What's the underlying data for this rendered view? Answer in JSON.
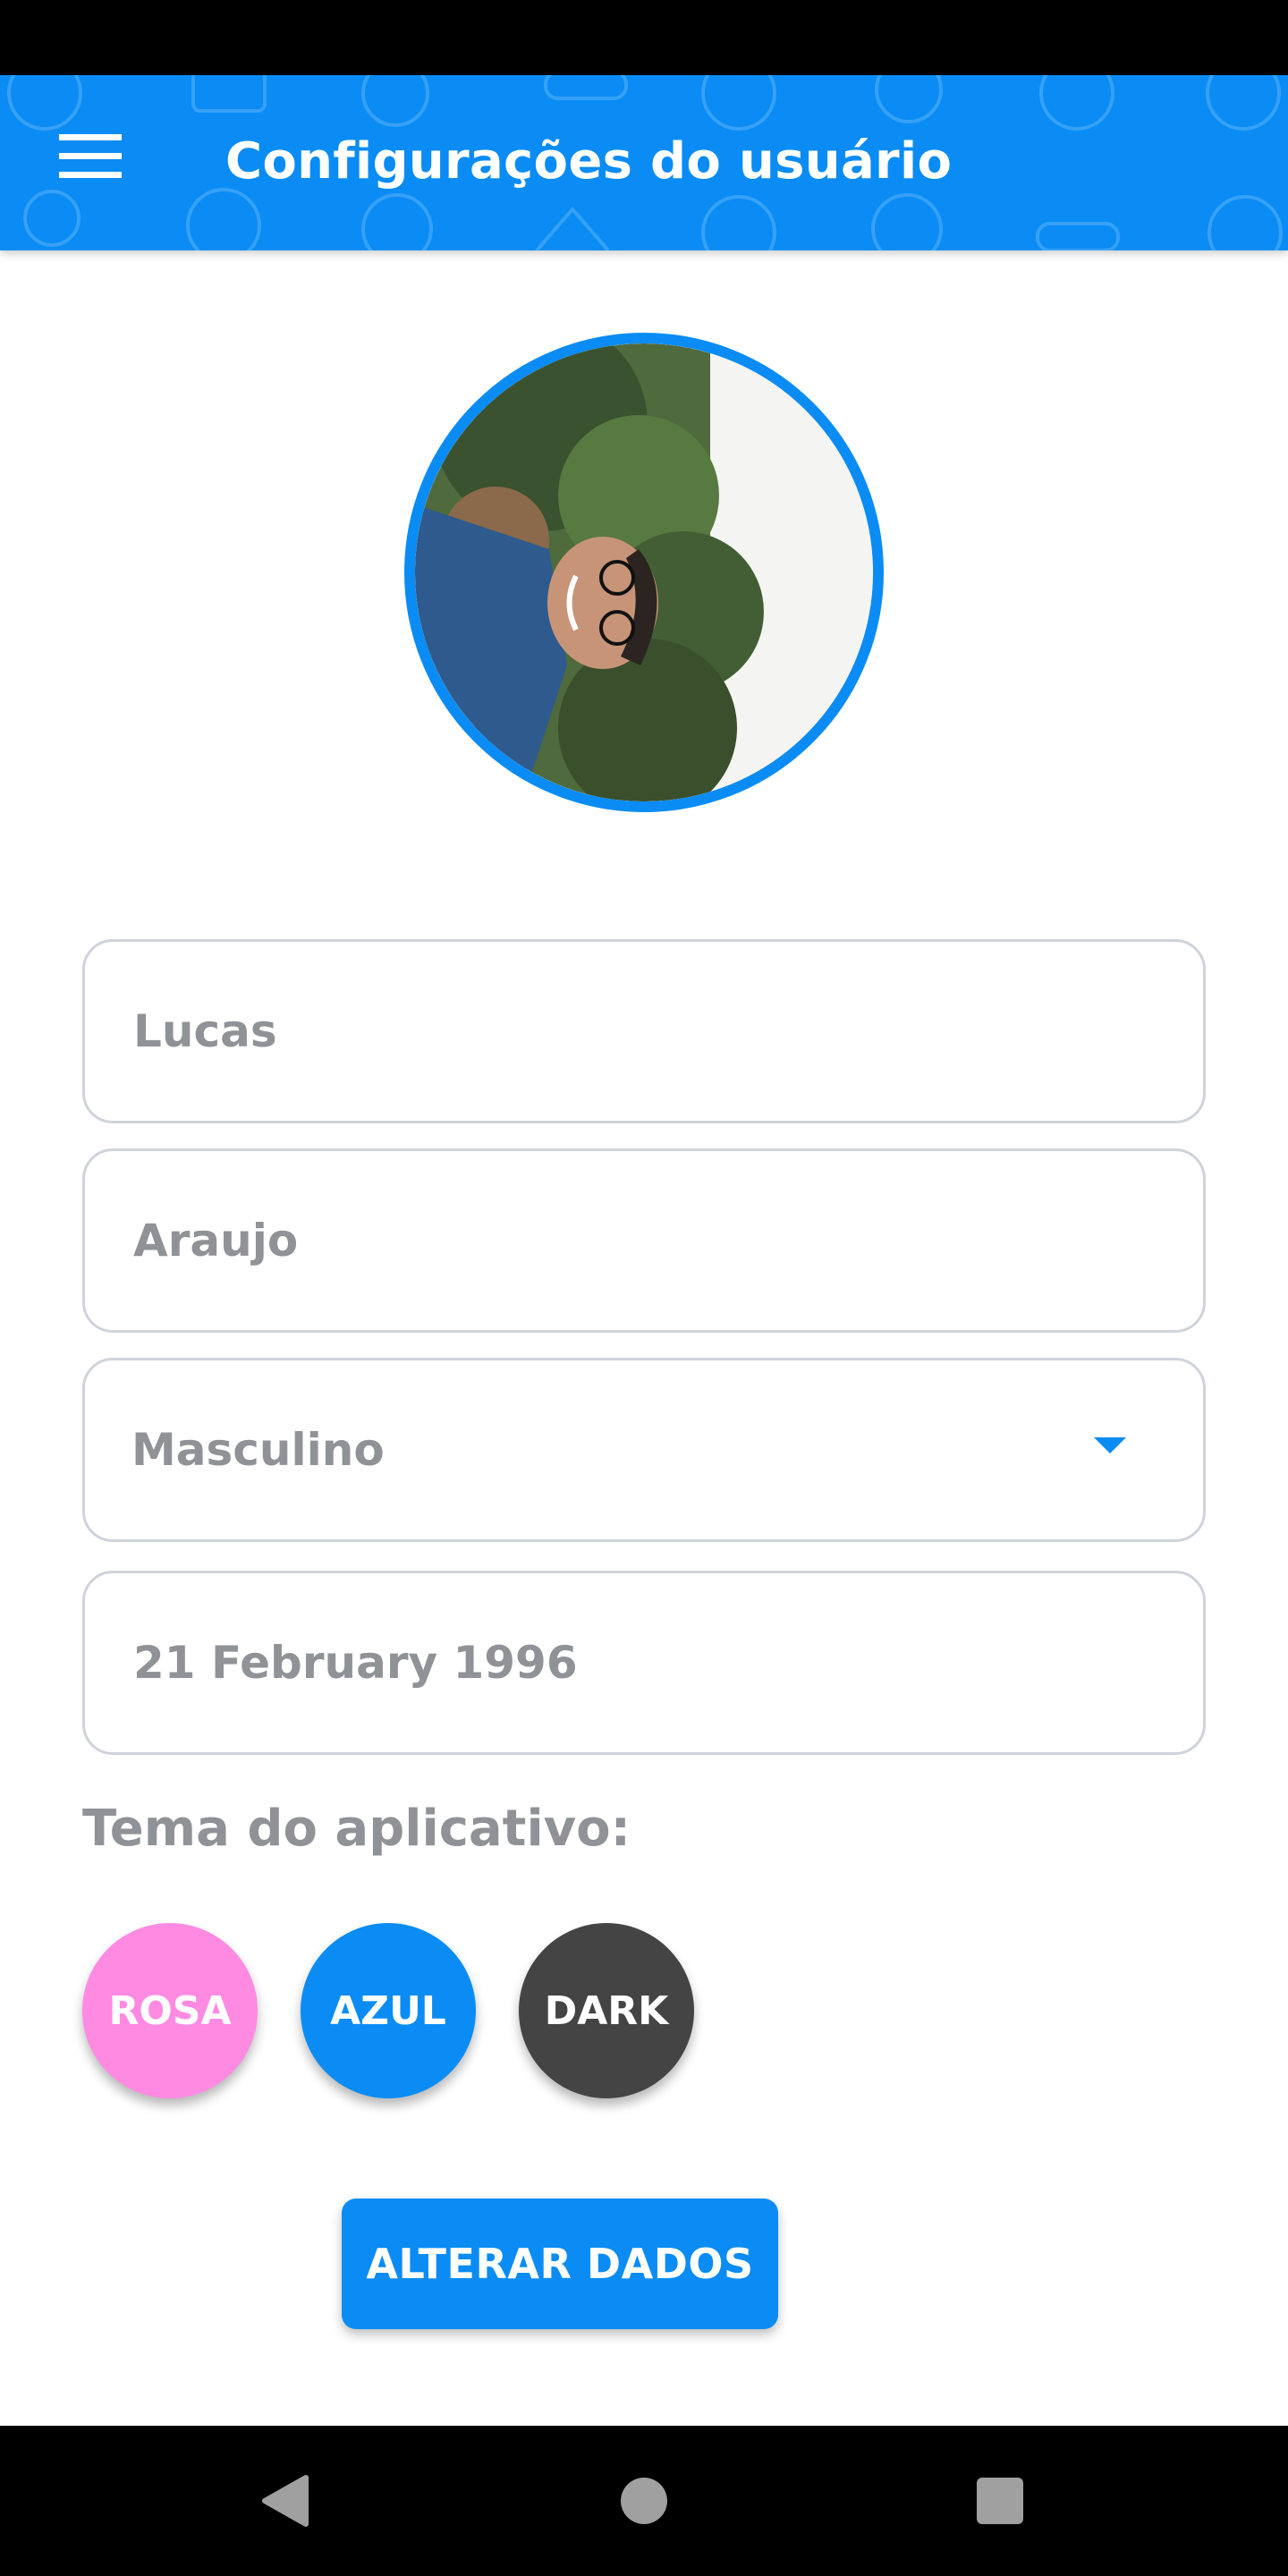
{
  "app_bar": {
    "title": "Configurações do usuário",
    "color": "#0a8cf4",
    "menu_icon": "hamburger-menu-icon"
  },
  "profile": {
    "photo_description": "profile-photo"
  },
  "form": {
    "first_name": {
      "value": "Lucas"
    },
    "last_name": {
      "value": "Araujo"
    },
    "gender": {
      "selected": "Masculino",
      "icon": "dropdown-arrow-icon"
    },
    "birth_date": {
      "value": "21 February 1996"
    }
  },
  "theme": {
    "label": "Tema do aplicativo:",
    "options": [
      {
        "label": "ROSA",
        "color": "#ff8ae2"
      },
      {
        "label": "AZUL",
        "color": "#0a8cf4"
      },
      {
        "label": "DARK",
        "color": "#444444"
      }
    ]
  },
  "actions": {
    "submit_label": "ALTERAR DADOS"
  },
  "navigation": {
    "back_icon": "back-triangle-icon",
    "home_icon": "home-circle-icon",
    "recents_icon": "recents-square-icon"
  }
}
